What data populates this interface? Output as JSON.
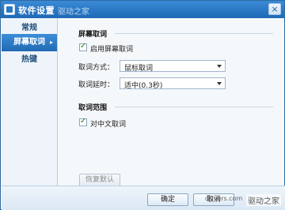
{
  "window": {
    "title": "软件设置",
    "title_watermark": "驱动之家"
  },
  "sidebar": {
    "items": [
      {
        "label": "常规"
      },
      {
        "label": "屏幕取词",
        "arrow": "▸"
      },
      {
        "label": "热键"
      }
    ]
  },
  "main": {
    "section1": {
      "title": "屏幕取词",
      "enable_label": "启用屏幕取词",
      "mode_label": "取词方式：",
      "mode_value": "鼠标取词",
      "delay_label": "取词延时：",
      "delay_value": "适中(0.3秒)"
    },
    "section2": {
      "title": "取词范围",
      "chinese_label": "对中文取词"
    },
    "restore_default": "恢复默认"
  },
  "footer": {
    "ok": "确定",
    "cancel": "取消",
    "watermark_url": "drivers.com",
    "watermark": "驱动之家"
  },
  "colors": {
    "titlebar": "#2b78c5",
    "active_tab": "#2169b3",
    "check": "#2c7a1f"
  }
}
